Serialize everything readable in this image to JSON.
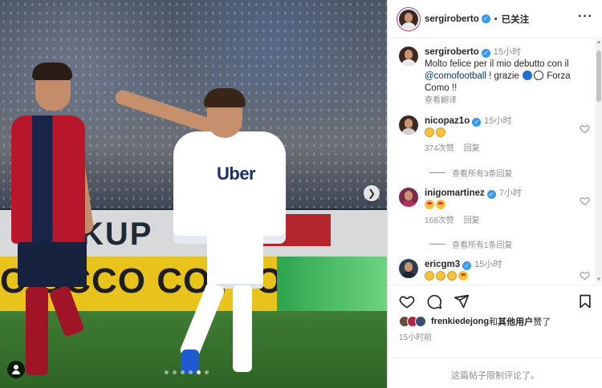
{
  "media": {
    "photo_description_icon": "photo",
    "board_text": "CIOCCO COTTO",
    "ad_text": "KUP",
    "sponsor_text": "Uber",
    "carousel": {
      "count": 6,
      "active_index": 4
    },
    "next_icon": "chevron-right-icon",
    "tag_icon": "user-tag-icon"
  },
  "header": {
    "username": "sergiroberto",
    "separator": "•",
    "follow_state": "已关注",
    "more_icon": "ellipsis-icon"
  },
  "caption": {
    "username": "sergiroberto",
    "time": "15小时",
    "text_before": "Molto felice per il mio debutto con il ",
    "mention": "@comofootball",
    "text_middle": " ! grazie ",
    "text_after": " Forza Como !!",
    "translate": "查看翻译"
  },
  "comments": [
    {
      "username": "nicopaz1o",
      "time": "15小时",
      "likes": "374次赞",
      "reply": "回复",
      "view_replies": "查看所有3条回复"
    },
    {
      "username": "inigomartinez",
      "time": "7小时",
      "likes": "168次赞",
      "reply": "回复",
      "view_replies": "查看所有1条回复"
    },
    {
      "username": "ericgm3",
      "time": "15小时"
    }
  ],
  "actions": {
    "like_icon": "heart-icon",
    "comment_icon": "comment-icon",
    "share_icon": "send-icon",
    "save_icon": "bookmark-icon"
  },
  "likes_summary": {
    "user": "frenkiedejong",
    "connector": "和",
    "others": "其他用户",
    "suffix": "赞了"
  },
  "post_time": "15小时前",
  "comment_limit": "这篇帖子限制评论了。",
  "colors": {
    "link": "#00376b",
    "verified": "#3897f0",
    "secondary_text": "#8e8e8e",
    "border": "#dbdbdb"
  }
}
